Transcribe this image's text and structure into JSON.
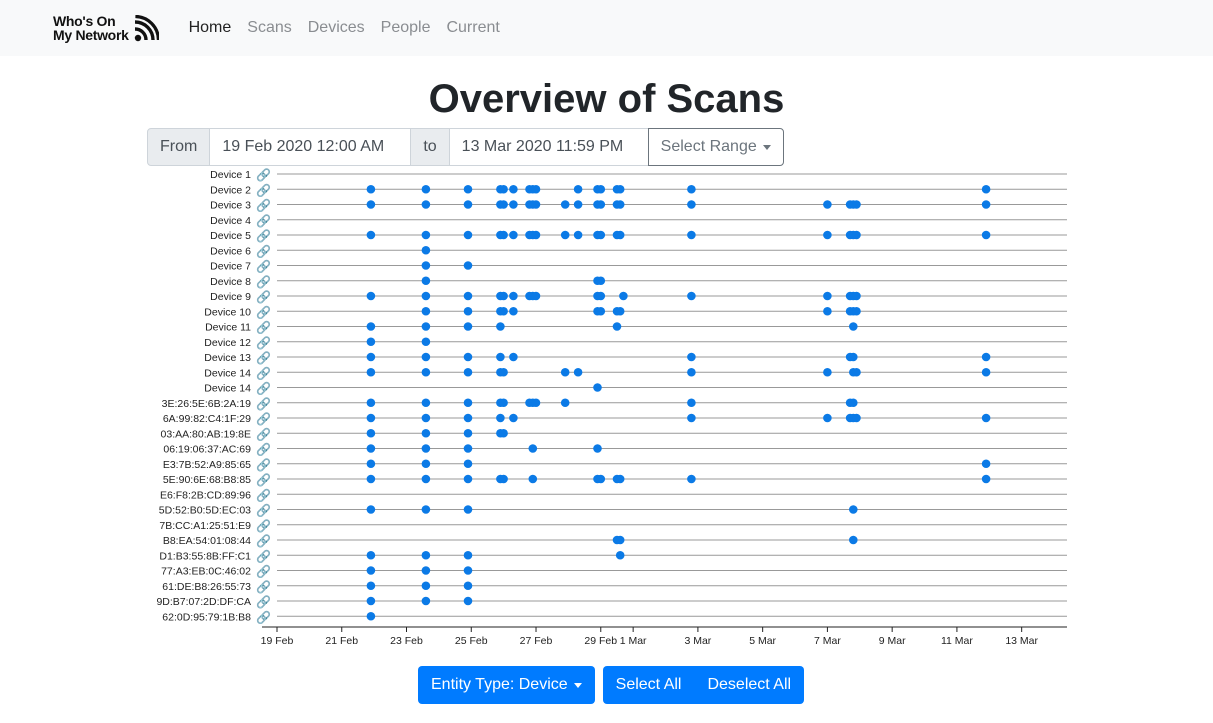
{
  "navbar": {
    "brand_line1": "Who's On",
    "brand_line2": "My Network",
    "links": [
      "Home",
      "Scans",
      "Devices",
      "People",
      "Current"
    ],
    "active": "Home"
  },
  "page": {
    "title": "Overview of Scans"
  },
  "range": {
    "from_label": "From",
    "from_value": "19 Feb 2020 12:00 AM",
    "to_label": "to",
    "to_value": "13 Mar 2020 11:59 PM",
    "select_label": "Select Range"
  },
  "controls": {
    "entity_type": "Entity Type: Device",
    "select_all": "Select All",
    "deselect_all": "Deselect All"
  },
  "colors": {
    "accent": "#007bff",
    "dot": "#0b7ae6",
    "gridline": "#999999"
  },
  "chart_data": {
    "type": "scatter",
    "x_unit": "date (Feb 19 – Mar 13, 2020)",
    "xlim": [
      "19 Feb",
      "13 Mar"
    ],
    "x_ticks": [
      "19 Feb",
      "21 Feb",
      "23 Feb",
      "25 Feb",
      "27 Feb",
      "29 Feb",
      "1 Mar",
      "3 Mar",
      "5 Mar",
      "7 Mar",
      "9 Mar",
      "11 Mar",
      "13 Mar"
    ],
    "tick_days": [
      0,
      2,
      4,
      6,
      8,
      10,
      11,
      13,
      15,
      17,
      19,
      21,
      23
    ],
    "legend": "none",
    "rows": [
      {
        "label": "Device 1",
        "days": []
      },
      {
        "label": "Device 2",
        "days": [
          2.9,
          4.6,
          5.9,
          6.9,
          7.0,
          7.3,
          7.8,
          7.9,
          8.0,
          9.3,
          9.9,
          10.0,
          10.5,
          10.6,
          12.8,
          21.9
        ]
      },
      {
        "label": "Device 3",
        "days": [
          2.9,
          4.6,
          5.9,
          6.9,
          7.0,
          7.3,
          7.8,
          7.9,
          8.0,
          8.9,
          9.3,
          9.9,
          10.0,
          10.5,
          10.6,
          12.8,
          17.0,
          17.7,
          17.8,
          17.9,
          21.9
        ]
      },
      {
        "label": "Device 4",
        "days": []
      },
      {
        "label": "Device 5",
        "days": [
          2.9,
          4.6,
          5.9,
          6.9,
          7.0,
          7.3,
          7.8,
          7.9,
          8.0,
          8.9,
          9.3,
          9.9,
          10.0,
          10.5,
          10.6,
          12.8,
          17.0,
          17.7,
          17.8,
          17.9,
          21.9
        ]
      },
      {
        "label": "Device 6",
        "days": [
          4.6
        ]
      },
      {
        "label": "Device 7",
        "days": [
          4.6,
          5.9
        ]
      },
      {
        "label": "Device 8",
        "days": [
          4.6,
          9.9,
          10.0
        ]
      },
      {
        "label": "Device 9",
        "days": [
          2.9,
          4.6,
          5.9,
          6.9,
          7.0,
          7.3,
          7.8,
          7.9,
          8.0,
          9.9,
          10.0,
          10.7,
          12.8,
          17.0,
          17.7,
          17.8,
          17.9
        ]
      },
      {
        "label": "Device 10",
        "days": [
          4.6,
          5.9,
          6.9,
          7.0,
          7.3,
          9.9,
          10.0,
          10.5,
          10.6,
          17.0,
          17.7,
          17.8,
          17.9
        ]
      },
      {
        "label": "Device 11",
        "days": [
          2.9,
          4.6,
          5.9,
          6.9,
          10.5,
          17.8
        ]
      },
      {
        "label": "Device 12",
        "days": [
          2.9,
          4.6
        ]
      },
      {
        "label": "Device 13",
        "days": [
          2.9,
          4.6,
          5.9,
          6.9,
          7.3,
          12.8,
          17.7,
          17.8,
          21.9
        ]
      },
      {
        "label": "Device 14",
        "days": [
          2.9,
          4.6,
          5.9,
          6.9,
          7.0,
          8.9,
          9.3,
          12.8,
          17.0,
          17.8,
          17.9,
          21.9
        ]
      },
      {
        "label": "Device 14",
        "days": [
          9.9
        ]
      },
      {
        "label": "3E:26:5E:6B:2A:19",
        "days": [
          2.9,
          4.6,
          5.9,
          6.9,
          7.0,
          7.8,
          7.9,
          8.0,
          8.9,
          12.8,
          17.7,
          17.8
        ]
      },
      {
        "label": "6A:99:82:C4:1F:29",
        "days": [
          2.9,
          4.6,
          5.9,
          6.9,
          7.3,
          12.8,
          17.0,
          17.7,
          17.8,
          17.9,
          21.9
        ]
      },
      {
        "label": "03:AA:80:AB:19:8E",
        "days": [
          2.9,
          4.6,
          5.9,
          6.9,
          7.0
        ]
      },
      {
        "label": "06:19:06:37:AC:69",
        "days": [
          2.9,
          4.6,
          5.9,
          7.9,
          9.9
        ]
      },
      {
        "label": "E3:7B:52:A9:85:65",
        "days": [
          2.9,
          4.6,
          5.9,
          21.9
        ]
      },
      {
        "label": "5E:90:6E:68:B8:85",
        "days": [
          2.9,
          4.6,
          5.9,
          6.9,
          7.0,
          7.9,
          9.9,
          10.0,
          10.5,
          10.6,
          12.8,
          21.9
        ]
      },
      {
        "label": "E6:F8:2B:CD:89:96",
        "days": []
      },
      {
        "label": "5D:52:B0:5D:EC:03",
        "days": [
          2.9,
          4.6,
          5.9,
          17.8
        ]
      },
      {
        "label": "7B:CC:A1:25:51:E9",
        "days": []
      },
      {
        "label": "B8:EA:54:01:08:44",
        "days": [
          10.5,
          10.6,
          17.8
        ]
      },
      {
        "label": "D1:B3:55:8B:FF:C1",
        "days": [
          2.9,
          4.6,
          5.9,
          10.6
        ]
      },
      {
        "label": "77:A3:EB:0C:46:02",
        "days": [
          2.9,
          4.6,
          5.9
        ]
      },
      {
        "label": "61:DE:B8:26:55:73",
        "days": [
          2.9,
          4.6,
          5.9
        ]
      },
      {
        "label": "9D:B7:07:2D:DF:CA",
        "days": [
          2.9,
          4.6,
          5.9
        ]
      },
      {
        "label": "62:0D:95:79:1B:B8",
        "days": [
          2.9
        ]
      }
    ]
  }
}
